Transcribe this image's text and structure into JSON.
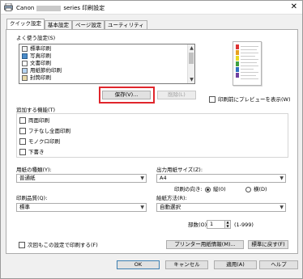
{
  "window": {
    "title_brand": "Canon",
    "title_suffix": "series 印刷設定",
    "close_glyph": "✕"
  },
  "tabs": [
    "クイック設定",
    "基本設定",
    "ページ設定",
    "ユーティリティ"
  ],
  "quick_settings": {
    "label": "よく使う設定(S)",
    "items": [
      "標準印刷",
      "写真印刷",
      "文書印刷",
      "用紙節約印刷",
      "封筒印刷"
    ],
    "save_label": "保存(V)...",
    "delete_label": "削除(L)",
    "preview_checkbox_label": "印刷前にプレビューを表示(W)",
    "preview_checked": false
  },
  "features": {
    "label": "追加する機能(T)",
    "options": [
      {
        "label": "両面印刷",
        "checked": false
      },
      {
        "label": "フチなし全面印刷",
        "checked": false
      },
      {
        "label": "モノクロ印刷",
        "checked": false
      },
      {
        "label": "下書き",
        "checked": false
      }
    ]
  },
  "media_type": {
    "label": "用紙の種類(Y):",
    "value": "普通紙"
  },
  "output_size": {
    "label": "出力用紙サイズ(Z):",
    "value": "A4"
  },
  "orientation": {
    "label": "印刷の向き:",
    "portrait": "縦(0)",
    "landscape": "横(D)",
    "selected": "portrait"
  },
  "quality": {
    "label": "印刷品質(Q):",
    "value": "標準"
  },
  "paper_source": {
    "label": "給紙方法(R):",
    "value": "自動選択"
  },
  "copies": {
    "label": "部数(O):",
    "value": "1",
    "range": "(1-999)"
  },
  "always_print_checkbox": {
    "label": "次回もこの設定で印刷する(F)",
    "checked": false
  },
  "printer_info_button": "プリンター用紙情報(M)...",
  "defaults_button": "標準に戻す(F)",
  "footer": {
    "ok": "OK",
    "cancel": "キャンセル",
    "apply": "適用(A)",
    "help": "ヘルプ"
  },
  "colors": {
    "highlight": "#e0262c"
  }
}
